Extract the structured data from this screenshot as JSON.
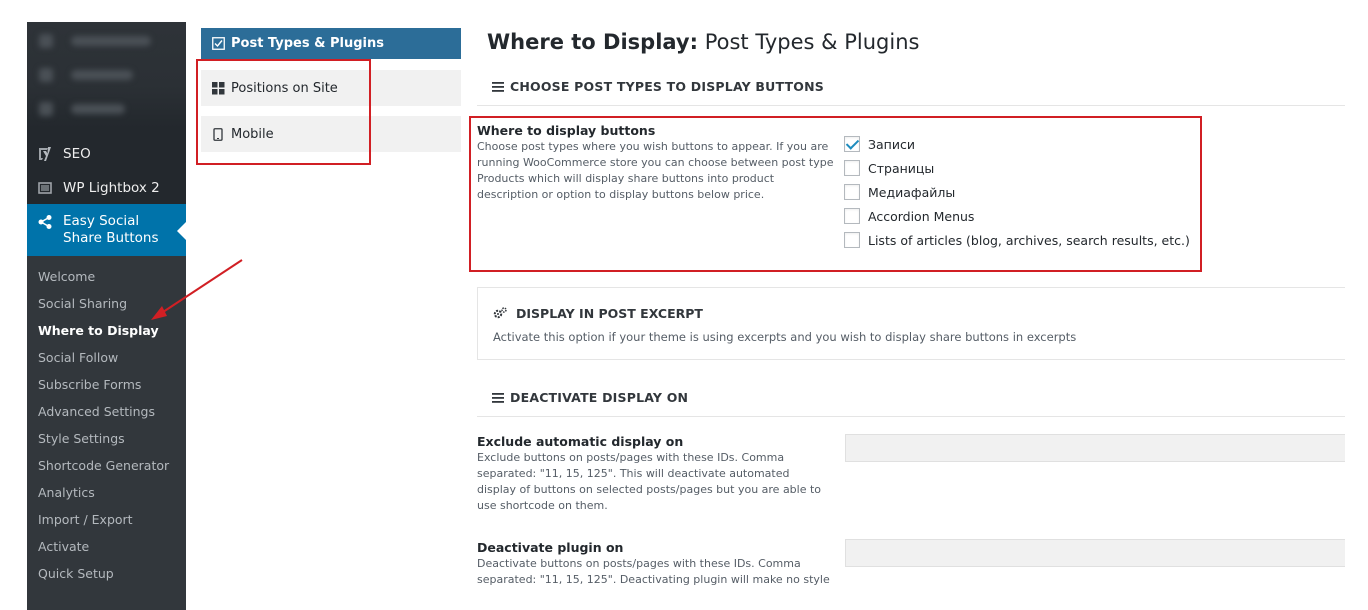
{
  "sidebar": {
    "menu": [
      {
        "label": "SEO",
        "icon": "yoast-seo-icon"
      },
      {
        "label": "WP Lightbox 2",
        "icon": "lightbox-icon"
      },
      {
        "label": "Easy Social Share Buttons",
        "icon": "share-icon",
        "current": true
      }
    ],
    "submenu": [
      {
        "label": "Welcome"
      },
      {
        "label": "Social Sharing"
      },
      {
        "label": "Where to Display",
        "active": true
      },
      {
        "label": "Social Follow"
      },
      {
        "label": "Subscribe Forms"
      },
      {
        "label": "Advanced Settings"
      },
      {
        "label": "Style Settings"
      },
      {
        "label": "Shortcode Generator"
      },
      {
        "label": "Analytics"
      },
      {
        "label": "Import / Export"
      },
      {
        "label": "Activate"
      },
      {
        "label": "Quick Setup"
      }
    ]
  },
  "nav": {
    "tabs": [
      {
        "label": "Post Types & Plugins",
        "icon": "checkbox-icon",
        "active": true
      },
      {
        "label": "Positions on Site",
        "icon": "grid-icon"
      },
      {
        "label": "Mobile",
        "icon": "mobile-icon"
      }
    ]
  },
  "page": {
    "title_bold": "Where to Display:",
    "title_rest": "Post Types & Plugins"
  },
  "section_post_types": {
    "heading": "CHOOSE POST TYPES TO DISPLAY BUTTONS",
    "field_label": "Where to display buttons",
    "field_desc": "Choose post types where you wish buttons to appear. If you are running WooCommerce store you can choose between post type Products which will display share buttons into product description or option to display buttons below price.",
    "options": [
      {
        "label": "Записи",
        "checked": true
      },
      {
        "label": "Страницы",
        "checked": false
      },
      {
        "label": "Медиафайлы",
        "checked": false
      },
      {
        "label": "Accordion Menus",
        "checked": false
      },
      {
        "label": "Lists of articles (blog, archives, search results, etc.)",
        "checked": false
      }
    ]
  },
  "section_excerpt": {
    "heading": "DISPLAY IN POST EXCERPT",
    "desc": "Activate this option if your theme is using excerpts and you wish to display share buttons in excerpts"
  },
  "section_deactivate": {
    "heading": "DEACTIVATE DISPLAY ON",
    "fields": [
      {
        "label": "Exclude automatic display on",
        "desc": "Exclude buttons on posts/pages with these IDs. Comma separated: \"11, 15, 125\". This will deactivate automated display of buttons on selected posts/pages but you are able to use shortcode on them.",
        "value": ""
      },
      {
        "label": "Deactivate plugin on",
        "desc": "Deactivate buttons on posts/pages with these IDs. Comma separated: \"11, 15, 125\". Deactivating plugin will make no style or scripts to be executed for those pages/posts. Plugin also",
        "value": ""
      }
    ]
  },
  "colors": {
    "sidebar_bg": "#23282d",
    "submenu_bg": "#32373c",
    "current_menu": "#0073aa",
    "active_tab": "#2c6d98",
    "annotation_red": "#d11f24"
  }
}
